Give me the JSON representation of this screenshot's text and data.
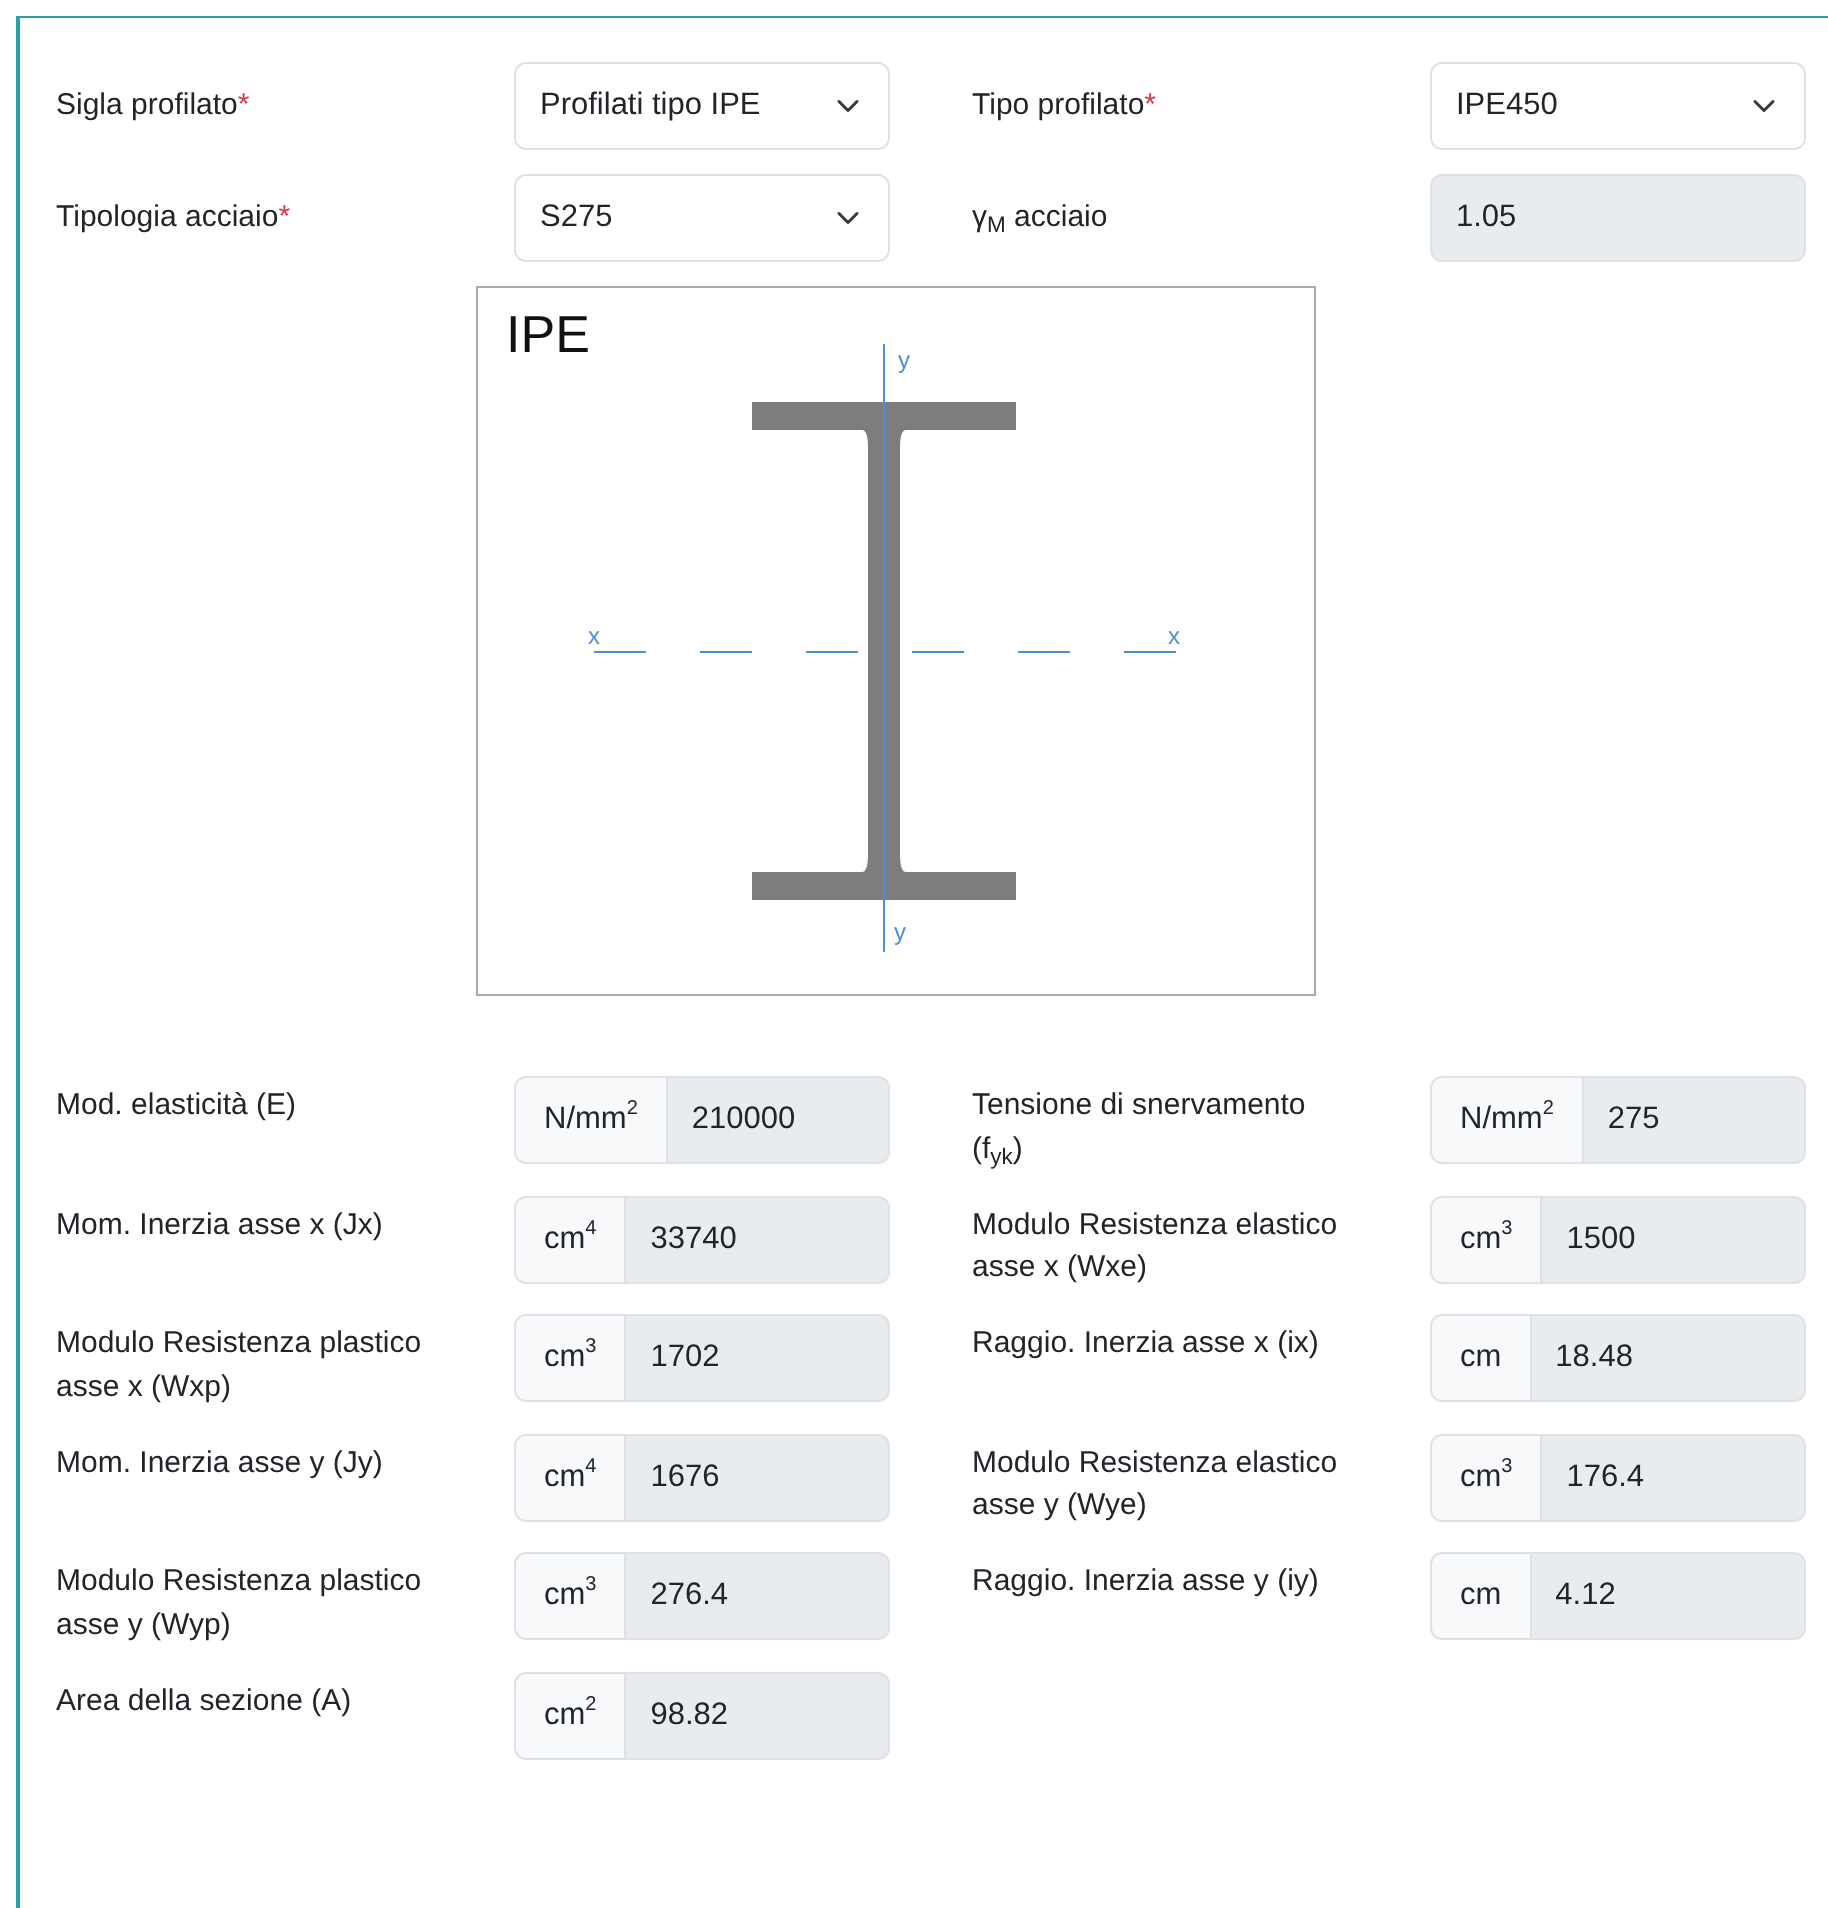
{
  "header_fields": [
    {
      "label": "Sigla profilato",
      "required_mark": "*",
      "kind": "select",
      "value": "Profilati tipo IPE"
    },
    {
      "label": "Tipo profilato",
      "required_mark": "*",
      "kind": "select",
      "value": "IPE450"
    },
    {
      "label": "Tipologia acciaio",
      "required_mark": "*",
      "kind": "select",
      "value": "S275"
    },
    {
      "label": "γ$_{M}$ acciaio",
      "kind": "readonly",
      "value": "1.05"
    }
  ],
  "section_drawing": {
    "title": "IPE",
    "y_axis_labels": [
      "y",
      "y"
    ],
    "x_axis_labels": [
      "x",
      "x"
    ]
  },
  "properties": [
    {
      "label": "Mod. elasticità (E)",
      "unit": "N/mm$^{2}$",
      "value": "210000"
    },
    {
      "label": "Tensione di snervamento (f$_{yk}$)",
      "unit": "N/mm$^{2}$",
      "value": "275"
    },
    {
      "label": "Mom. Inerzia asse x (Jx)",
      "unit": "cm$^{4}$",
      "value": "33740"
    },
    {
      "label": "Modulo Resistenza elastico asse x (Wxe)",
      "unit": "cm$^{3}$",
      "value": "1500"
    },
    {
      "label": "Modulo Resistenza plastico asse x (Wxp)",
      "unit": "cm$^{3}$",
      "value": "1702"
    },
    {
      "label": "Raggio. Inerzia asse x (ix)",
      "unit": "cm",
      "value": "18.48"
    },
    {
      "label": "Mom. Inerzia asse y (Jy)",
      "unit": "cm$^{4}$",
      "value": "1676"
    },
    {
      "label": "Modulo Resistenza elastico asse y (Wye)",
      "unit": "cm$^{3}$",
      "value": "176.4"
    },
    {
      "label": "Modulo Resistenza plastico asse y (Wyp)",
      "unit": "cm$^{3}$",
      "value": "276.4"
    },
    {
      "label": "Raggio. Inerzia asse y (iy)",
      "unit": "cm",
      "value": "4.12"
    },
    {
      "label": "Area della sezione (A)",
      "unit": "cm$^{2}$",
      "value": "98.82"
    }
  ]
}
